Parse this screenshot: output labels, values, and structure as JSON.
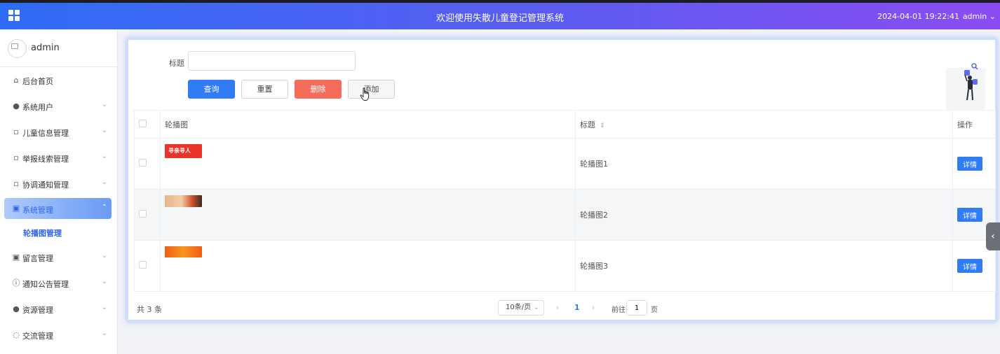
{
  "header": {
    "title": "欢迎使用失散儿童登记管理系统",
    "datetime": "2024-04-01 19:22:41",
    "user": "admin",
    "user_chevron": "⌄"
  },
  "sidebar": {
    "profile_name": "admin",
    "items": [
      {
        "label": "后台首页",
        "icon": "home-icon",
        "glyph": "⌂",
        "chevron": ""
      },
      {
        "label": "系统用户",
        "icon": "user-icon",
        "glyph": "●",
        "chevron": "⌄"
      },
      {
        "label": "儿童信息管理",
        "icon": "document-icon",
        "glyph": "▫",
        "chevron": "⌄"
      },
      {
        "label": "举报线索管理",
        "icon": "document-icon",
        "glyph": "▫",
        "chevron": "⌄"
      },
      {
        "label": "协调通知管理",
        "icon": "document-icon",
        "glyph": "▫",
        "chevron": "⌄"
      },
      {
        "label": "系统管理",
        "icon": "picture-icon",
        "glyph": "▣",
        "chevron": "⌃"
      },
      {
        "label": "留言管理",
        "icon": "picture-icon",
        "glyph": "▣",
        "chevron": "⌄"
      },
      {
        "label": "通知公告管理",
        "icon": "info-icon",
        "glyph": "ⓘ",
        "chevron": "⌄"
      },
      {
        "label": "资源管理",
        "icon": "location-icon",
        "glyph": "●",
        "chevron": "⌄"
      },
      {
        "label": "交流管理",
        "icon": "chat-icon",
        "glyph": "◌",
        "chevron": "⌄"
      }
    ],
    "active_submenu": "轮播图管理"
  },
  "search": {
    "label": "标题",
    "value": "",
    "placeholder": ""
  },
  "buttons": {
    "query": "查询",
    "reset": "重置",
    "delete": "删除",
    "add": "添加"
  },
  "table": {
    "columns": [
      "轮播图",
      "标题",
      "操作"
    ],
    "sort_icon": "⇕",
    "rows": [
      {
        "image_caption": "寻亲寻人",
        "image_color": "#e8342a",
        "title": "轮播图1",
        "action": "详情"
      },
      {
        "image_caption": "",
        "image_color": "#e8b894",
        "title": "轮播图2",
        "action": "详情"
      },
      {
        "image_caption": "",
        "image_color": "#f25c15",
        "title": "轮播图3",
        "action": "详情"
      }
    ]
  },
  "pager": {
    "total": "共 3 条",
    "page_size": "10条/页",
    "prev": "‹",
    "current": "1",
    "next": "›",
    "goto_label": "前往",
    "goto_value": "1",
    "goto_suffix": "页"
  },
  "colors": {
    "primary": "#2f7cf5",
    "danger": "#f56c5a",
    "header_start": "#2e6cf5",
    "header_end": "#8a4cf2"
  }
}
